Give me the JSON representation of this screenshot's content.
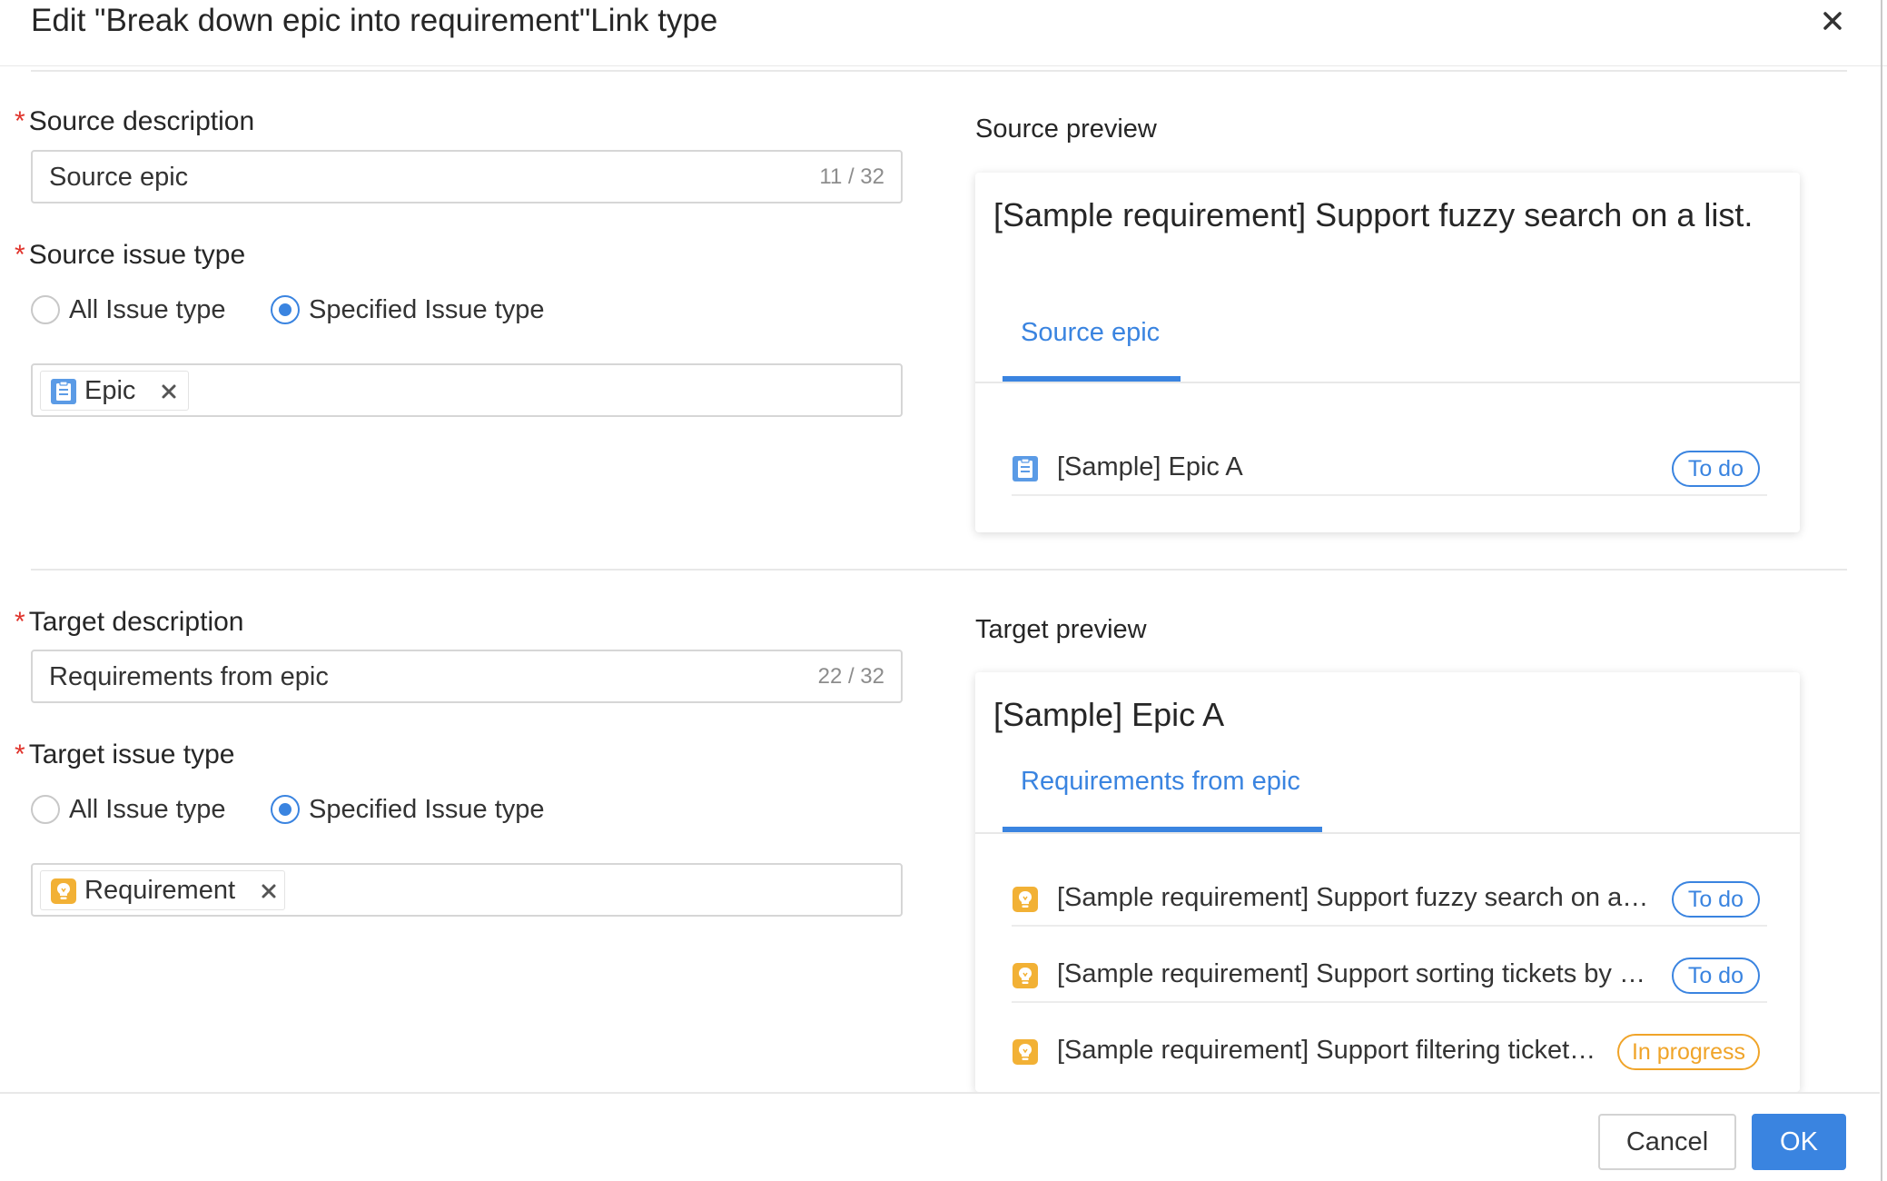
{
  "dialog": {
    "title": "Edit \"Break down epic into requirement\"Link type",
    "cancel_label": "Cancel",
    "ok_label": "OK"
  },
  "source": {
    "description_label": "Source description",
    "description_value": "Source epic",
    "description_count": "11 / 32",
    "issue_type_label": "Source issue type",
    "radio_all": "All Issue type",
    "radio_specified": "Specified Issue type",
    "selected_radio": "specified",
    "tags": [
      {
        "label": "Epic",
        "icon": "epic-icon"
      }
    ]
  },
  "target": {
    "description_label": "Target description",
    "description_value": "Requirements from epic",
    "description_count": "22 / 32",
    "issue_type_label": "Target issue type",
    "radio_all": "All Issue type",
    "radio_specified": "Specified Issue type",
    "selected_radio": "specified",
    "tags": [
      {
        "label": "Requirement",
        "icon": "requirement-icon"
      }
    ]
  },
  "source_preview": {
    "label": "Source preview",
    "title": "[Sample requirement] Support fuzzy search on a list.",
    "tab": "Source epic",
    "items": [
      {
        "icon": "epic-icon",
        "text": "[Sample] Epic A",
        "status": "To do"
      }
    ]
  },
  "target_preview": {
    "label": "Target preview",
    "title": "[Sample] Epic A",
    "tab": "Requirements from epic",
    "items": [
      {
        "icon": "requirement-icon",
        "text": "[Sample requirement] Support fuzzy search on a l…",
        "status": "To do"
      },
      {
        "icon": "requirement-icon",
        "text": "[Sample requirement] Support sorting tickets by …",
        "status": "To do"
      },
      {
        "icon": "requirement-icon",
        "text": "[Sample requirement] Support filtering ticket…",
        "status": "In progress"
      }
    ]
  },
  "colors": {
    "accent": "#3a84e0",
    "required": "#e0342c",
    "in_progress": "#f0a429",
    "epic_icon": "#5b9be6",
    "requirement_icon": "#f2b135"
  }
}
